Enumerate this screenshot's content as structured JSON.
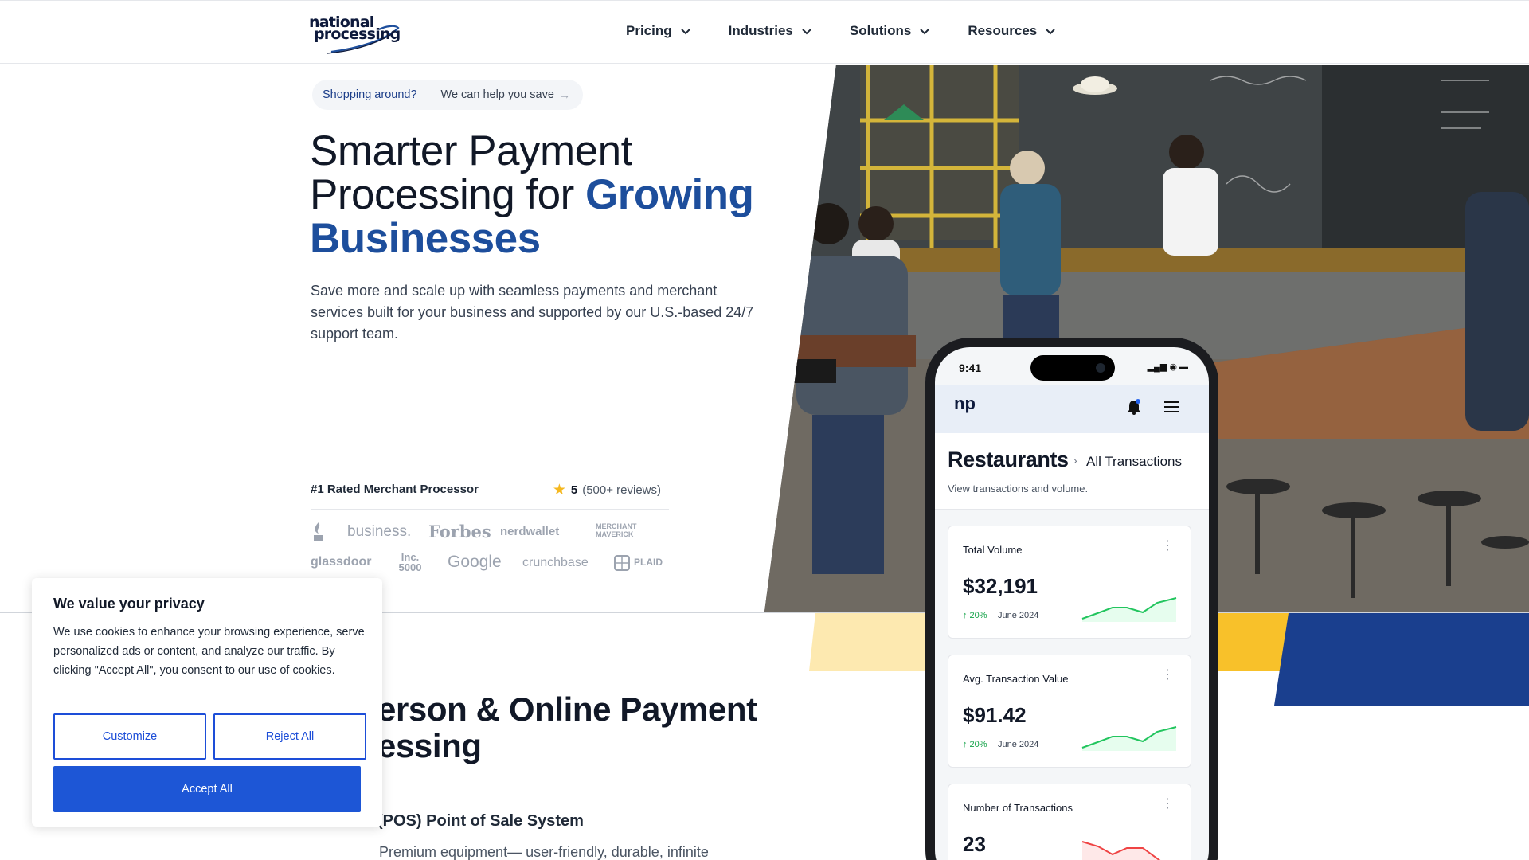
{
  "logo": {
    "line1": "national",
    "line2": "processing"
  },
  "nav": {
    "items": [
      {
        "label": "Pricing"
      },
      {
        "label": "Industries"
      },
      {
        "label": "Solutions"
      },
      {
        "label": "Resources"
      }
    ]
  },
  "hero": {
    "pill": {
      "left": "Shopping around?",
      "right": "We can help you save",
      "arrow": "→"
    },
    "headline_plain": "Smarter Payment Processing for",
    "headline_accent": "Growing Businesses",
    "subtext": "Save more and scale up with seamless payments and merchant services built for your business and supported by our U.S.-based 24/7 support team.",
    "rated": {
      "label": "#1 Rated Merchant Processor",
      "score": "5",
      "reviews": "(500+ reviews)"
    },
    "press": {
      "bbb": "BBB",
      "business": "business.",
      "forbes": "Forbes",
      "nerdwallet": "nerdwallet",
      "merchant_maverick": "MERCHANT MAVERICK",
      "glassdoor": "glassdoor",
      "inc": "Inc. 5000",
      "google": "Google",
      "crunchbase": "crunchbase",
      "plaid": "PLAID"
    }
  },
  "section": {
    "heading_line1": "erson & Online Payment",
    "heading_line2": "essing",
    "pos_title": "(POS) Point of Sale System",
    "pos_text": "Premium equipment— user-friendly, durable, infinite"
  },
  "phone": {
    "time": "9:41",
    "brand": "np",
    "title": "Restaurants",
    "breadcrumb": "All Transactions",
    "subtitle": "View transactions and volume.",
    "cards": [
      {
        "title": "Total Volume",
        "value": "$32,191",
        "change": "↑ 20%",
        "period": "June 2024"
      },
      {
        "title": "Avg. Transaction Value",
        "value": "$91.42",
        "change": "↑ 20%",
        "period": "June 2024"
      },
      {
        "title": "Number of Transactions",
        "value": "23"
      }
    ]
  },
  "cookie": {
    "title": "We value your privacy",
    "body": "We use cookies to enhance your browsing experience, serve personalized ads or content, and analyze our traffic. By clicking \"Accept All\", you consent to our use of cookies.",
    "customize": "Customize",
    "reject": "Reject All",
    "accept": "Accept All"
  },
  "colors": {
    "brand_blue": "#1d4e9c",
    "accent_yellow": "#f8c12a",
    "button_blue": "#1d56d6"
  }
}
